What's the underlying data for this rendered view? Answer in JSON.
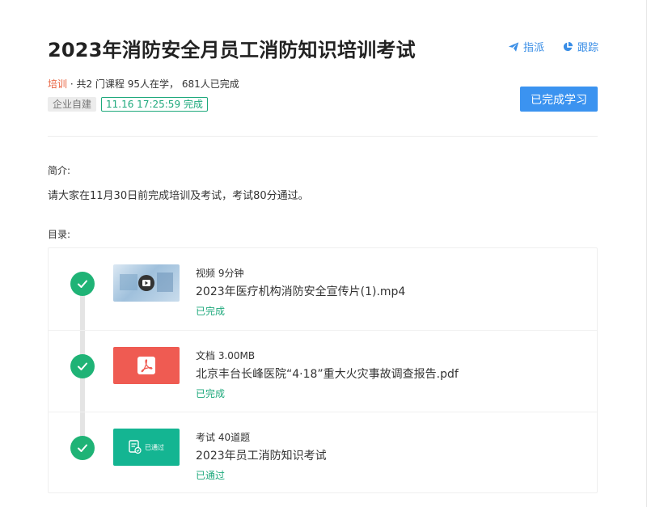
{
  "header": {
    "title": "2023年消防安全月员工消防知识培训考试",
    "assign_label": "指派",
    "track_label": "跟踪"
  },
  "meta": {
    "category": "培训",
    "summary": "· 共2 门课程 95人在学， 681人已完成"
  },
  "tags": {
    "source": "企业自建",
    "completed": "11.16 17:25:59 完成"
  },
  "done_button": "已完成学习",
  "intro": {
    "label": "简介:",
    "text": "请大家在11月30日前完成培训及考试，考试80分通过。"
  },
  "catalog": {
    "label": "目录:",
    "items": [
      {
        "type": "视频 9分钟",
        "name": "2023年医疗机构消防安全宣传片(1).mp4",
        "status": "已完成",
        "thumb": "video"
      },
      {
        "type": "文档 3.00MB",
        "name": "北京丰台长峰医院“4·18”重大火灾事故调查报告.pdf",
        "status": "已完成",
        "thumb": "pdf"
      },
      {
        "type": "考试 40道题",
        "name": "2023年员工消防知识考试",
        "status": "已通过",
        "thumb": "exam",
        "thumb_label": "已通过"
      }
    ]
  },
  "colors": {
    "accent": "#3b93f0",
    "success": "#1fb376",
    "category": "#e8603c",
    "pdf": "#ef5b52",
    "exam": "#14b592"
  }
}
